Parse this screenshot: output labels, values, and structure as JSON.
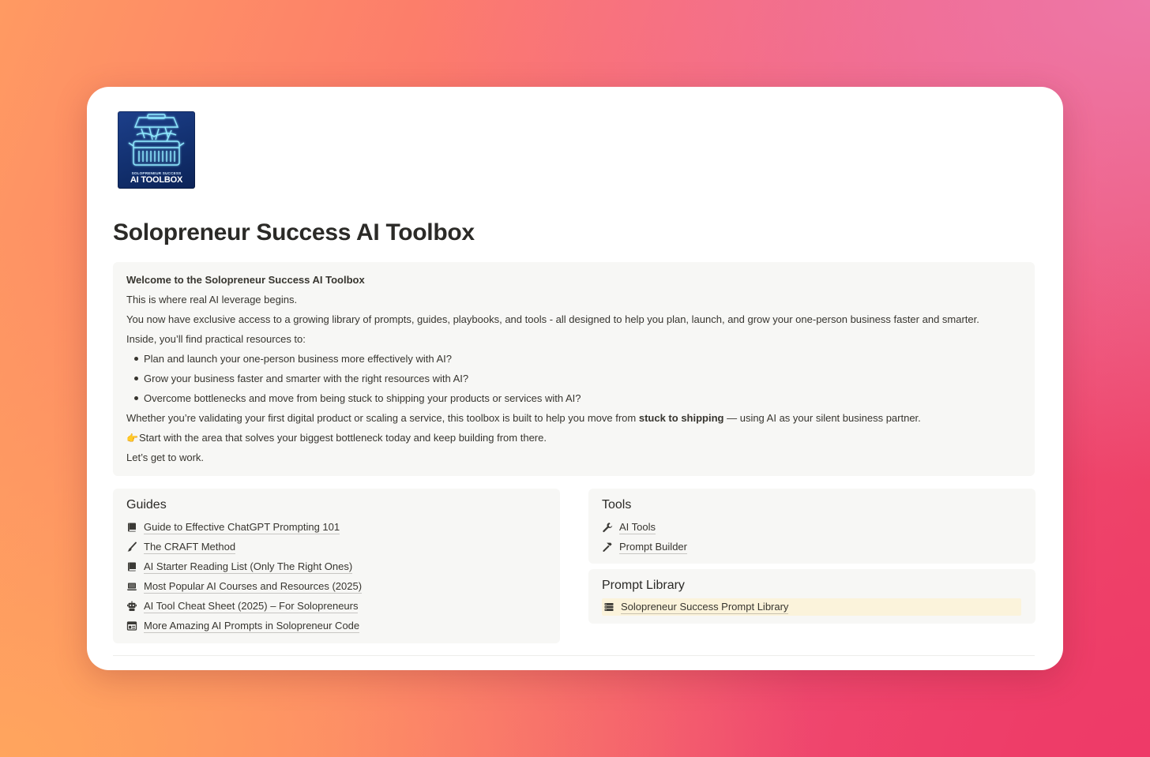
{
  "logo": {
    "icon": "toolbox-logo",
    "small_text": "SOLOPRENEUR SUCCESS",
    "big_text": "AI TOOLBOX",
    "background_color": "#163777",
    "glow_color": "#7fe6ff"
  },
  "page": {
    "title": "Solopreneur Success AI Toolbox"
  },
  "callout": {
    "heading": "Welcome to the Solopreneur Success AI Toolbox",
    "line1": "This is where real AI leverage begins.",
    "line2": "You now have exclusive access to a growing library of prompts, guides, playbooks, and tools - all designed to help you plan, launch, and grow your one-person business faster and smarter.",
    "line3": "Inside, you’ll find practical resources to:",
    "bullets": [
      "Plan and launch your one-person business more effectively with AI?",
      "Grow your business faster and smarter with the right resources with AI?",
      "Overcome bottlenecks and move from being stuck to shipping your products or services with AI?"
    ],
    "line4_before": "Whether you’re validating your first digital product or scaling a service, this toolbox is built to help you move from ",
    "line4_bold": "stuck to shipping",
    "line4_after": " — using AI as your silent business partner.",
    "line5_emoji": "👉",
    "line5": "Start with the area that solves your biggest bottleneck today and keep building from there.",
    "line6": "Let’s get to work."
  },
  "guides": {
    "title": "Guides",
    "items": [
      {
        "label": "Guide to Effective ChatGPT Prompting 101",
        "icon": "book-icon"
      },
      {
        "label": "The CRAFT Method",
        "icon": "paintbrush-icon"
      },
      {
        "label": "AI Starter Reading List (Only The Right Ones)",
        "icon": "book-icon"
      },
      {
        "label": "Most Popular AI Courses and Resources (2025)",
        "icon": "laptop-icon"
      },
      {
        "label": "AI Tool Cheat Sheet (2025) – For Solopreneurs",
        "icon": "robot-icon"
      },
      {
        "label": "More Amazing AI Prompts in Solopreneur Code",
        "icon": "window-icon"
      }
    ]
  },
  "tools": {
    "title": "Tools",
    "items": [
      {
        "label": "AI Tools",
        "icon": "wrench-icon"
      },
      {
        "label": "Prompt Builder",
        "icon": "hammer-icon"
      }
    ]
  },
  "prompt_library": {
    "title": "Prompt Library",
    "items": [
      {
        "label": "Solopreneur Success Prompt Library",
        "icon": "database-icon",
        "highlight_color": "#fbf3db"
      }
    ]
  }
}
